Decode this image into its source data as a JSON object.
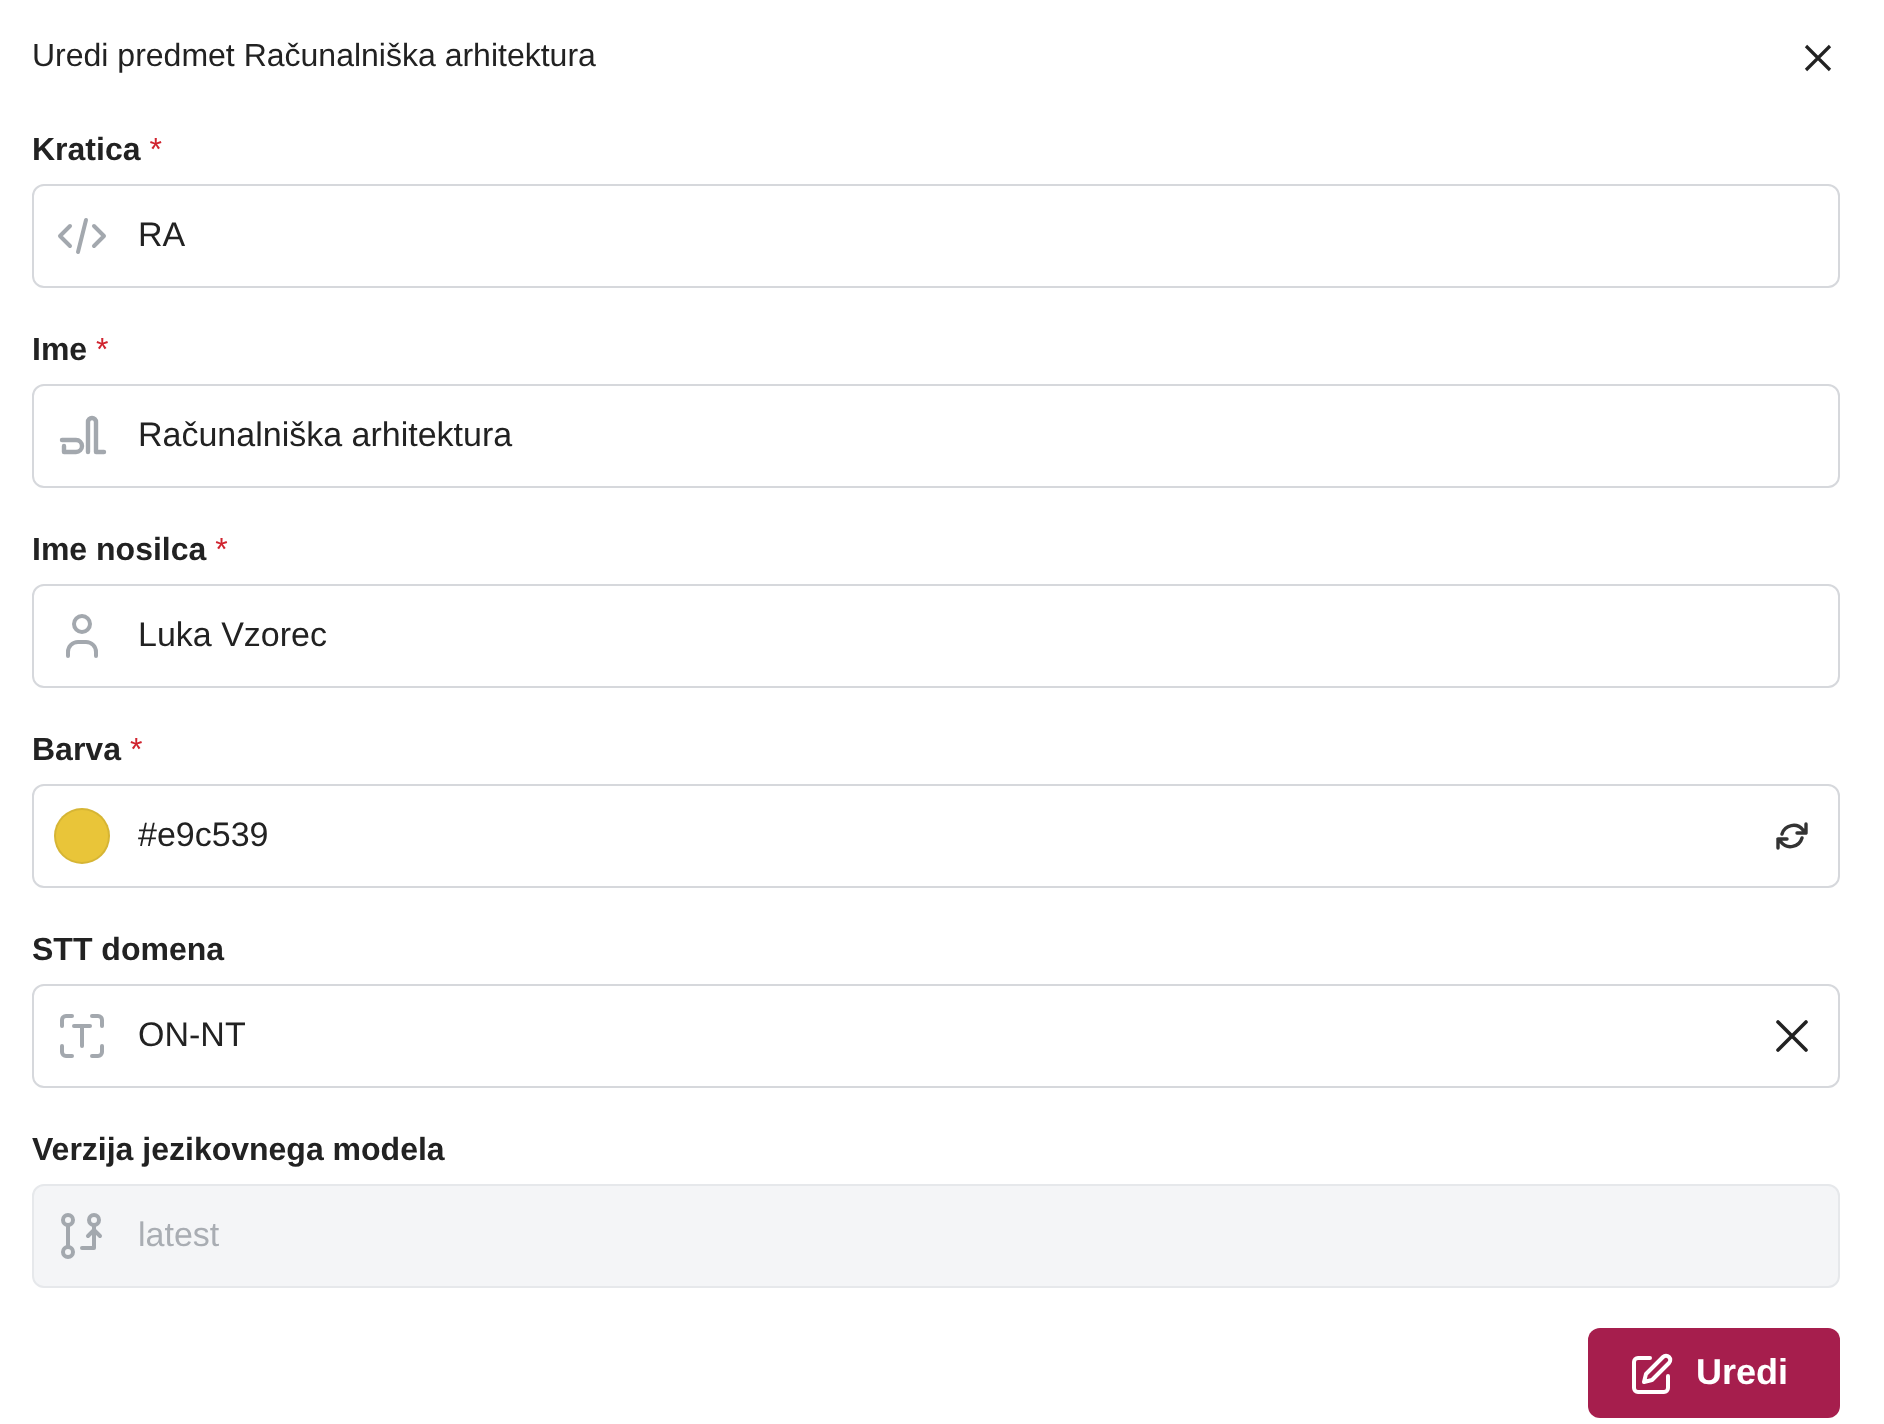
{
  "dialog": {
    "title": "Uredi predmet Računalniška arhitektura"
  },
  "fields": [
    {
      "kind": "text",
      "label": "Kratica",
      "required_mark": "*",
      "value": "RA",
      "disabled": false
    },
    {
      "kind": "text",
      "label": "Ime",
      "required_mark": "*",
      "value": "Računalniška arhitektura",
      "disabled": false
    },
    {
      "kind": "text",
      "label": "Ime nosilca",
      "required_mark": "*",
      "value": "Luka Vzorec",
      "disabled": false
    },
    {
      "kind": "color",
      "label": "Barva",
      "required_mark": "*",
      "color": "#e9c539",
      "value": "#e9c539",
      "disabled": false
    },
    {
      "kind": "clearable",
      "label": "STT domena",
      "value": "ON-NT",
      "disabled": false
    },
    {
      "kind": "text",
      "label": "Verzija jezikovnega modela",
      "value": "latest",
      "disabled": true
    }
  ],
  "submit": {
    "label": "Uredi"
  }
}
